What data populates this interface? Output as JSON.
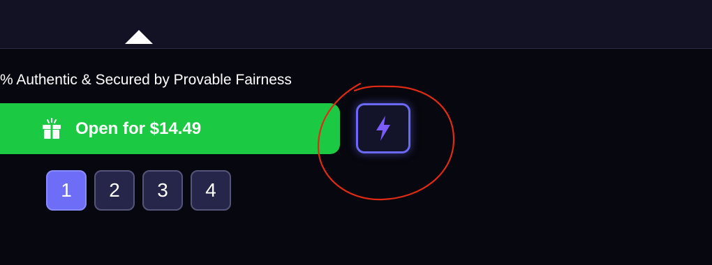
{
  "notice": {
    "text": "% Authentic & Secured by Provable Fairness"
  },
  "open_button": {
    "label": "Open for $14.49",
    "icon": "gift-icon",
    "color": "#1cc943"
  },
  "fast_open": {
    "icon": "lightning-bolt-icon",
    "accent": "#6a6af7"
  },
  "count_selector": {
    "options": [
      "1",
      "2",
      "3",
      "4"
    ],
    "selected": "1"
  },
  "annotation": {
    "color": "#e02a14"
  }
}
